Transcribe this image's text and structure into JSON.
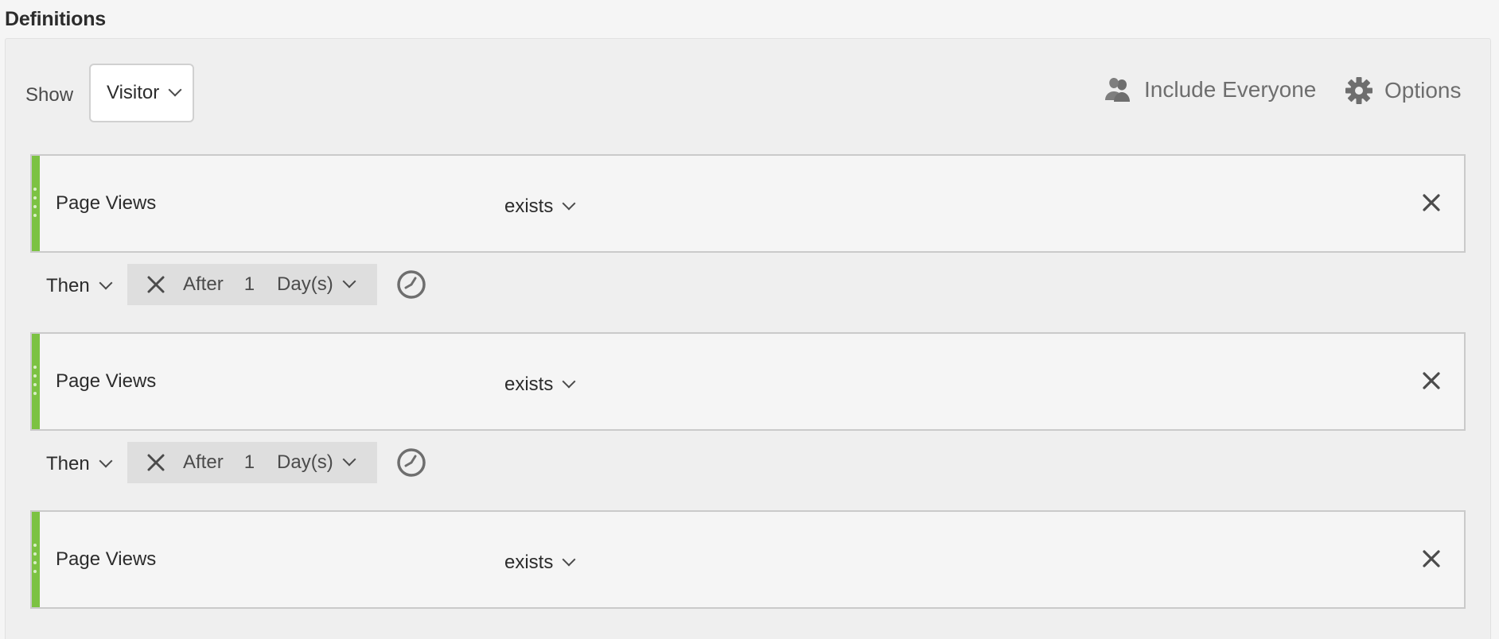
{
  "section": {
    "title": "Definitions"
  },
  "header": {
    "show_label": "Show",
    "show_value": "Visitor",
    "include_everyone": "Include Everyone",
    "options": "Options"
  },
  "rules": [
    {
      "metric": "Page Views",
      "operator": "exists"
    },
    {
      "metric": "Page Views",
      "operator": "exists"
    },
    {
      "metric": "Page Views",
      "operator": "exists"
    }
  ],
  "then_rows": [
    {
      "then_label": "Then",
      "after_label": "After",
      "amount": "1",
      "unit": "Day(s)"
    },
    {
      "then_label": "Then",
      "after_label": "After",
      "amount": "1",
      "unit": "Day(s)"
    }
  ],
  "colors": {
    "grip": "#7cc243",
    "panel": "#efefef",
    "within_box": "#dedede"
  },
  "icons": [
    "users-icon",
    "gear-icon",
    "close-icon",
    "chevron-down-icon",
    "clock-icon",
    "drag-handle-icon"
  ]
}
